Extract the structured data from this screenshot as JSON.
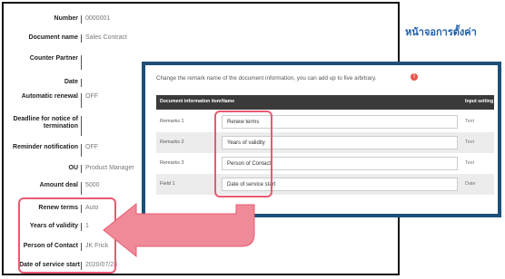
{
  "record": {
    "fields": [
      {
        "label": "Number",
        "value": "0000001"
      },
      {
        "label": "Document name",
        "value": "Sales Contract"
      },
      {
        "label": "Counter Partner",
        "value": ""
      },
      {
        "label": "Date",
        "value": ""
      },
      {
        "label": "Automatic renewal",
        "value": "OFF"
      },
      {
        "label": "Deadline for notice of termination",
        "value": ""
      },
      {
        "label": "Reminder notification",
        "value": "OFF"
      },
      {
        "label": "OU",
        "value": "Product Manager"
      },
      {
        "label": "Amount deal",
        "value": "5000"
      },
      {
        "label": "Renew terms",
        "value": "Auto"
      },
      {
        "label": "Years of validity",
        "value": "1"
      },
      {
        "label": "Person of Contact",
        "value": "JK Frick"
      },
      {
        "label": "Date of service start",
        "value": "2020/07/23"
      }
    ]
  },
  "heading": "หน้าจอการตั้งค่า",
  "dialog": {
    "description": "Change the remark name of the document information, you can add up to five arbitrary.",
    "info_badge": "!",
    "table": {
      "headers": {
        "item": "Document information item",
        "name": "Name",
        "setting": "Input setting"
      },
      "rows": [
        {
          "item": "Remarks 1",
          "name": "Renew terms",
          "setting": "Text"
        },
        {
          "item": "Remarks 2",
          "name": "Years of validity",
          "setting": "Text"
        },
        {
          "item": "Remarks 3",
          "name": "Person of Contact",
          "setting": "Text"
        },
        {
          "item": "Field 1",
          "name": "Date of service start",
          "setting": "Date"
        }
      ]
    }
  },
  "colors": {
    "highlight": "#e85a70",
    "dialog_border": "#1b4f79",
    "heading": "#1f5fa8",
    "table_header": "#3a3a3a"
  }
}
